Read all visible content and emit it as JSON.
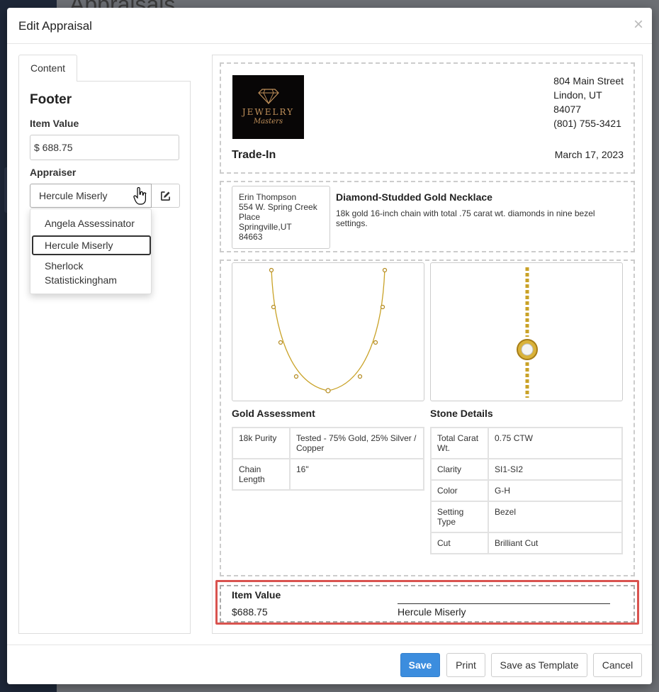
{
  "background": {
    "page_title": "Appraisals"
  },
  "modal": {
    "title": "Edit Appraisal",
    "close_glyph": "×"
  },
  "editor": {
    "tab_label": "Content",
    "section_title": "Footer",
    "item_value_label": "Item Value",
    "item_value": "$ 688.75",
    "appraiser_label": "Appraiser",
    "appraiser_selected": "Hercule Miserly",
    "appraiser_options": [
      "Angela Assessinator",
      "Hercule Miserly",
      "Sherlock Statistickingham"
    ]
  },
  "preview": {
    "logo": {
      "line1": "JEWELRY",
      "line2": "Masters"
    },
    "address": [
      "804 Main Street",
      "Lindon, UT",
      "84077",
      "(801) 755-3421"
    ],
    "doc_type": "Trade-In",
    "date": "March 17, 2023",
    "customer": {
      "name": "Erin Thompson",
      "street": "554 W. Spring Creek Place",
      "city": "Springville,UT",
      "zip": "84663"
    },
    "item": {
      "title": "Diamond-Studded Gold Necklace",
      "description": "18k gold 16-inch chain with total .75 carat wt. diamonds in nine bezel settings."
    },
    "gold_assessment": {
      "title": "Gold Assessment",
      "rows": [
        {
          "label": "18k Purity",
          "value": "Tested - 75% Gold, 25% Silver / Copper"
        },
        {
          "label": "Chain Length",
          "value": "16\""
        }
      ]
    },
    "stone_details": {
      "title": "Stone Details",
      "rows": [
        {
          "label": "Total Carat Wt.",
          "value": "0.75 CTW"
        },
        {
          "label": "Clarity",
          "value": "SI1-SI2"
        },
        {
          "label": "Color",
          "value": "G-H"
        },
        {
          "label": "Setting Type",
          "value": "Bezel"
        },
        {
          "label": "Cut",
          "value": "Brilliant Cut"
        }
      ]
    },
    "footer": {
      "label": "Item Value",
      "value": "$688.75",
      "appraiser": "Hercule Miserly"
    }
  },
  "buttons": {
    "save": "Save",
    "print": "Print",
    "save_template": "Save as Template",
    "cancel": "Cancel"
  },
  "colors": {
    "primary": "#3c8dde",
    "highlight": "#d9534f",
    "gold": "#c9a227"
  }
}
